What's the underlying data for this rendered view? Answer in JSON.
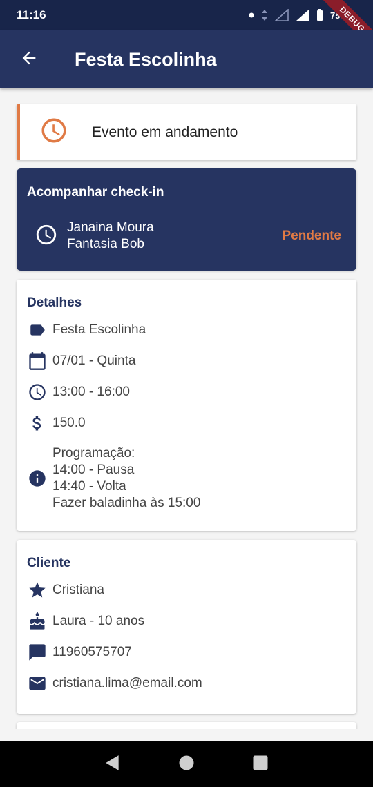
{
  "status_bar": {
    "time": "11:16",
    "battery": "75%"
  },
  "debug_banner": "DEBUG",
  "app_bar": {
    "title": "Festa Escolinha"
  },
  "event_status": {
    "text": "Evento em andamento"
  },
  "checkin": {
    "title": "Acompanhar check-in",
    "name": "Janaina Moura",
    "costume": "Fantasia Bob",
    "status": "Pendente"
  },
  "details": {
    "title": "Detalhes",
    "name": "Festa Escolinha",
    "date": "07/01 - Quinta",
    "time": "13:00 - 16:00",
    "price": "150.0",
    "notes": "Programação:\n14:00 - Pausa\n14:40 - Volta\nFazer baladinha às 15:00"
  },
  "client": {
    "title": "Cliente",
    "name": "Cristiana",
    "birthday_child": "Laura - 10 anos",
    "phone": "11960575707",
    "email": "cristiana.lima@email.com"
  },
  "colors": {
    "primary": "#263461",
    "accent": "#e07a45",
    "background": "#f4f4f4"
  }
}
